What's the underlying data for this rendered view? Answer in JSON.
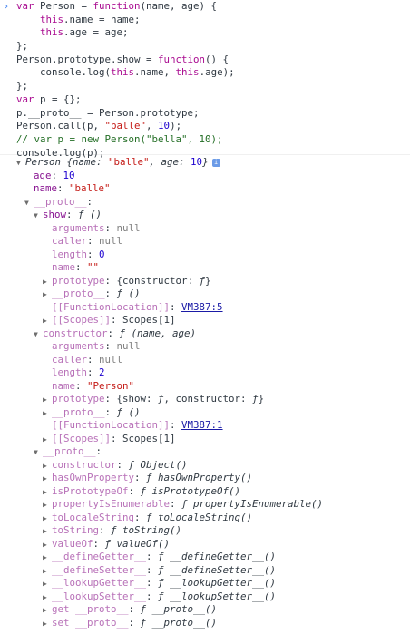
{
  "input_prompt": "›",
  "code_lines": [
    {
      "parts": [
        [
          "kw",
          "var"
        ],
        [
          "plain",
          " Person = "
        ],
        [
          "kw",
          "function"
        ],
        [
          "plain",
          "(name, age) {"
        ]
      ]
    },
    {
      "parts": [
        [
          "plain",
          "    "
        ],
        [
          "this",
          "this"
        ],
        [
          "plain",
          ".name = name;"
        ]
      ]
    },
    {
      "parts": [
        [
          "plain",
          "    "
        ],
        [
          "this",
          "this"
        ],
        [
          "plain",
          ".age = age;"
        ]
      ]
    },
    {
      "parts": [
        [
          "plain",
          "};"
        ]
      ]
    },
    {
      "parts": [
        [
          "plain",
          "Person.prototype.show = "
        ],
        [
          "kw",
          "function"
        ],
        [
          "plain",
          "() {"
        ]
      ]
    },
    {
      "parts": [
        [
          "plain",
          "    console.log("
        ],
        [
          "this",
          "this"
        ],
        [
          "plain",
          ".name, "
        ],
        [
          "this",
          "this"
        ],
        [
          "plain",
          ".age);"
        ]
      ]
    },
    {
      "parts": [
        [
          "plain",
          "};"
        ]
      ]
    },
    {
      "parts": [
        [
          "kw",
          "var"
        ],
        [
          "plain",
          " p = {};"
        ]
      ]
    },
    {
      "parts": [
        [
          "plain",
          "p.__proto__ = Person.prototype;"
        ]
      ]
    },
    {
      "parts": [
        [
          "plain",
          "Person.call(p, "
        ],
        [
          "str",
          "\"balle\""
        ],
        [
          "plain",
          ", "
        ],
        [
          "num",
          "10"
        ],
        [
          "plain",
          ");"
        ]
      ]
    },
    {
      "parts": [
        [
          "cmt",
          "// var p = new Person(\"bella\", 10);"
        ]
      ]
    },
    {
      "parts": [
        [
          "plain",
          "console.log(p);"
        ]
      ]
    }
  ],
  "output_rows": [
    {
      "indent": 0,
      "tri": "▼",
      "parts": [
        [
          "obj-title",
          "Person {name: "
        ],
        [
          "val-str",
          "\"balle\""
        ],
        [
          "obj-title",
          ", age: "
        ],
        [
          "val-num",
          "10"
        ],
        [
          "obj-title",
          "}"
        ]
      ],
      "info": "i"
    },
    {
      "indent": 1,
      "tri": "",
      "parts": [
        [
          "key",
          "age"
        ],
        [
          "plain",
          ": "
        ],
        [
          "val-num",
          "10"
        ]
      ]
    },
    {
      "indent": 1,
      "tri": "",
      "parts": [
        [
          "key",
          "name"
        ],
        [
          "plain",
          ": "
        ],
        [
          "val-str",
          "\"balle\""
        ]
      ]
    },
    {
      "indent": 1,
      "tri": "▼",
      "parts": [
        [
          "key-dim",
          "__proto__"
        ],
        [
          "plain",
          ":"
        ]
      ]
    },
    {
      "indent": 2,
      "tri": "▼",
      "parts": [
        [
          "key",
          "show"
        ],
        [
          "plain",
          ": "
        ],
        [
          "fsym",
          "ƒ ()"
        ]
      ]
    },
    {
      "indent": 3,
      "tri": "",
      "parts": [
        [
          "key-dim",
          "arguments"
        ],
        [
          "plain",
          ": "
        ],
        [
          "val-null",
          "null"
        ]
      ]
    },
    {
      "indent": 3,
      "tri": "",
      "parts": [
        [
          "key-dim",
          "caller"
        ],
        [
          "plain",
          ": "
        ],
        [
          "val-null",
          "null"
        ]
      ]
    },
    {
      "indent": 3,
      "tri": "",
      "parts": [
        [
          "key-dim",
          "length"
        ],
        [
          "plain",
          ": "
        ],
        [
          "val-num",
          "0"
        ]
      ]
    },
    {
      "indent": 3,
      "tri": "",
      "parts": [
        [
          "key-dim",
          "name"
        ],
        [
          "plain",
          ": "
        ],
        [
          "val-str",
          "\"\""
        ]
      ]
    },
    {
      "indent": 3,
      "tri": "▶",
      "parts": [
        [
          "key-dim",
          "prototype"
        ],
        [
          "plain",
          ": {constructor: "
        ],
        [
          "fsym",
          "ƒ"
        ],
        [
          "plain",
          "}"
        ]
      ]
    },
    {
      "indent": 3,
      "tri": "▶",
      "parts": [
        [
          "key-dim",
          "__proto__"
        ],
        [
          "plain",
          ": "
        ],
        [
          "fsym",
          "ƒ ()"
        ]
      ]
    },
    {
      "indent": 3,
      "tri": "",
      "parts": [
        [
          "key-dim",
          "[[FunctionLocation]]"
        ],
        [
          "plain",
          ": "
        ],
        [
          "link",
          "VM387:5"
        ]
      ]
    },
    {
      "indent": 3,
      "tri": "▶",
      "parts": [
        [
          "key-dim",
          "[[Scopes]]"
        ],
        [
          "plain",
          ": Scopes[1]"
        ]
      ]
    },
    {
      "indent": 2,
      "tri": "▼",
      "parts": [
        [
          "key-dim",
          "constructor"
        ],
        [
          "plain",
          ": "
        ],
        [
          "fsym",
          "ƒ (name, age)"
        ]
      ]
    },
    {
      "indent": 3,
      "tri": "",
      "parts": [
        [
          "key-dim",
          "arguments"
        ],
        [
          "plain",
          ": "
        ],
        [
          "val-null",
          "null"
        ]
      ]
    },
    {
      "indent": 3,
      "tri": "",
      "parts": [
        [
          "key-dim",
          "caller"
        ],
        [
          "plain",
          ": "
        ],
        [
          "val-null",
          "null"
        ]
      ]
    },
    {
      "indent": 3,
      "tri": "",
      "parts": [
        [
          "key-dim",
          "length"
        ],
        [
          "plain",
          ": "
        ],
        [
          "val-num",
          "2"
        ]
      ]
    },
    {
      "indent": 3,
      "tri": "",
      "parts": [
        [
          "key-dim",
          "name"
        ],
        [
          "plain",
          ": "
        ],
        [
          "val-str",
          "\"Person\""
        ]
      ]
    },
    {
      "indent": 3,
      "tri": "▶",
      "parts": [
        [
          "key-dim",
          "prototype"
        ],
        [
          "plain",
          ": {show: "
        ],
        [
          "fsym",
          "ƒ"
        ],
        [
          "plain",
          ", constructor: "
        ],
        [
          "fsym",
          "ƒ"
        ],
        [
          "plain",
          "}"
        ]
      ]
    },
    {
      "indent": 3,
      "tri": "▶",
      "parts": [
        [
          "key-dim",
          "__proto__"
        ],
        [
          "plain",
          ": "
        ],
        [
          "fsym",
          "ƒ ()"
        ]
      ]
    },
    {
      "indent": 3,
      "tri": "",
      "parts": [
        [
          "key-dim",
          "[[FunctionLocation]]"
        ],
        [
          "plain",
          ": "
        ],
        [
          "link",
          "VM387:1"
        ]
      ]
    },
    {
      "indent": 3,
      "tri": "▶",
      "parts": [
        [
          "key-dim",
          "[[Scopes]]"
        ],
        [
          "plain",
          ": Scopes[1]"
        ]
      ]
    },
    {
      "indent": 2,
      "tri": "▼",
      "parts": [
        [
          "key-dim",
          "__proto__"
        ],
        [
          "plain",
          ":"
        ]
      ]
    },
    {
      "indent": 3,
      "tri": "▶",
      "parts": [
        [
          "key-dim",
          "constructor"
        ],
        [
          "plain",
          ": "
        ],
        [
          "fsym",
          "ƒ Object()"
        ]
      ]
    },
    {
      "indent": 3,
      "tri": "▶",
      "parts": [
        [
          "key-dim",
          "hasOwnProperty"
        ],
        [
          "plain",
          ": "
        ],
        [
          "fsym",
          "ƒ hasOwnProperty()"
        ]
      ]
    },
    {
      "indent": 3,
      "tri": "▶",
      "parts": [
        [
          "key-dim",
          "isPrototypeOf"
        ],
        [
          "plain",
          ": "
        ],
        [
          "fsym",
          "ƒ isPrototypeOf()"
        ]
      ]
    },
    {
      "indent": 3,
      "tri": "▶",
      "parts": [
        [
          "key-dim",
          "propertyIsEnumerable"
        ],
        [
          "plain",
          ": "
        ],
        [
          "fsym",
          "ƒ propertyIsEnumerable()"
        ]
      ]
    },
    {
      "indent": 3,
      "tri": "▶",
      "parts": [
        [
          "key-dim",
          "toLocaleString"
        ],
        [
          "plain",
          ": "
        ],
        [
          "fsym",
          "ƒ toLocaleString()"
        ]
      ]
    },
    {
      "indent": 3,
      "tri": "▶",
      "parts": [
        [
          "key-dim",
          "toString"
        ],
        [
          "plain",
          ": "
        ],
        [
          "fsym",
          "ƒ toString()"
        ]
      ]
    },
    {
      "indent": 3,
      "tri": "▶",
      "parts": [
        [
          "key-dim",
          "valueOf"
        ],
        [
          "plain",
          ": "
        ],
        [
          "fsym",
          "ƒ valueOf()"
        ]
      ]
    },
    {
      "indent": 3,
      "tri": "▶",
      "parts": [
        [
          "key-dim",
          "__defineGetter__"
        ],
        [
          "plain",
          ": "
        ],
        [
          "fsym",
          "ƒ __defineGetter__()"
        ]
      ]
    },
    {
      "indent": 3,
      "tri": "▶",
      "parts": [
        [
          "key-dim",
          "__defineSetter__"
        ],
        [
          "plain",
          ": "
        ],
        [
          "fsym",
          "ƒ __defineSetter__()"
        ]
      ]
    },
    {
      "indent": 3,
      "tri": "▶",
      "parts": [
        [
          "key-dim",
          "__lookupGetter__"
        ],
        [
          "plain",
          ": "
        ],
        [
          "fsym",
          "ƒ __lookupGetter__()"
        ]
      ]
    },
    {
      "indent": 3,
      "tri": "▶",
      "parts": [
        [
          "key-dim",
          "__lookupSetter__"
        ],
        [
          "plain",
          ": "
        ],
        [
          "fsym",
          "ƒ __lookupSetter__()"
        ]
      ]
    },
    {
      "indent": 3,
      "tri": "▶",
      "parts": [
        [
          "key-dim",
          "get __proto__"
        ],
        [
          "plain",
          ": "
        ],
        [
          "fsym",
          "ƒ __proto__()"
        ]
      ]
    },
    {
      "indent": 3,
      "tri": "▶",
      "parts": [
        [
          "key-dim",
          "set __proto__"
        ],
        [
          "plain",
          ": "
        ],
        [
          "fsym",
          "ƒ __proto__()"
        ]
      ]
    }
  ]
}
